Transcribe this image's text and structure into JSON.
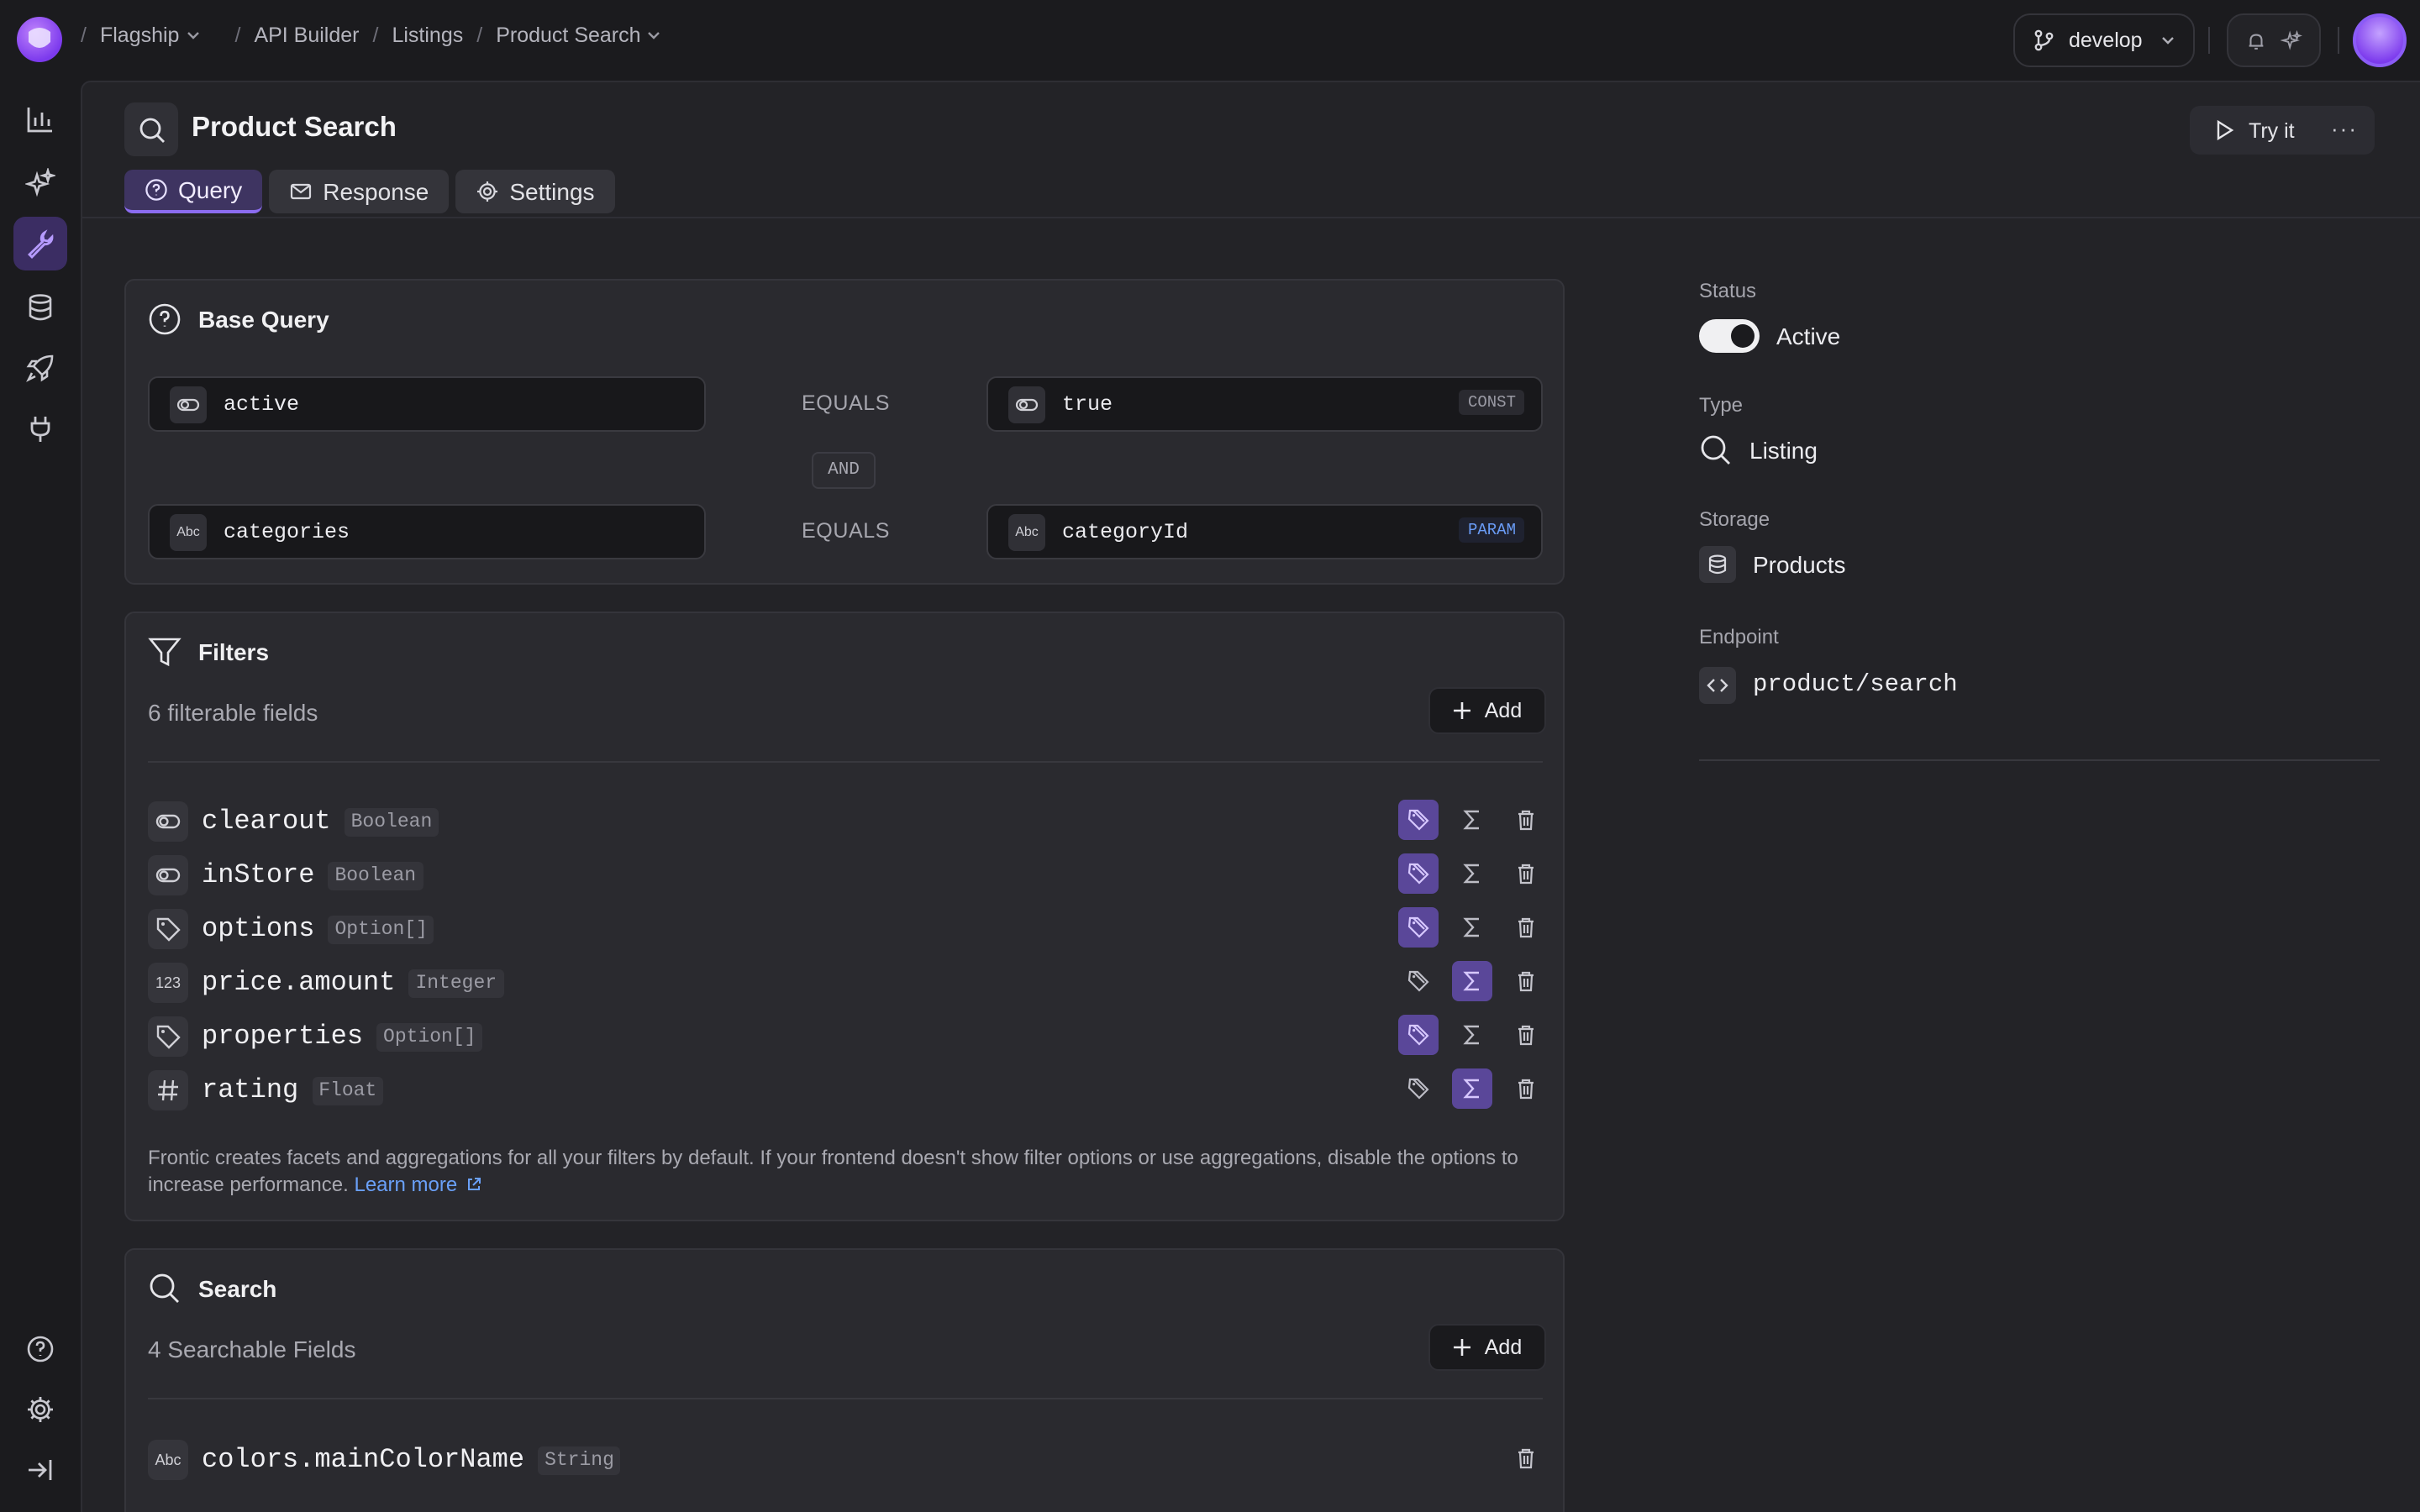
{
  "breadcrumbs": [
    {
      "label": "Flagship",
      "dropdown": true
    },
    {
      "label": "API Builder",
      "dropdown": false
    },
    {
      "label": "Listings",
      "dropdown": false
    },
    {
      "label": "Product Search",
      "dropdown": true
    }
  ],
  "branch": {
    "label": "develop"
  },
  "page": {
    "title": "Product Search",
    "try_label": "Try it",
    "more_label": "···",
    "tabs": [
      {
        "label": "Query",
        "icon": "question-circle-icon",
        "active": true
      },
      {
        "label": "Response",
        "icon": "envelope-icon",
        "active": false
      },
      {
        "label": "Settings",
        "icon": "gear-icon",
        "active": false
      }
    ]
  },
  "base_query": {
    "title": "Base Query",
    "operator_and": "AND",
    "conditions": [
      {
        "field": "active",
        "field_icon": "toggle-icon",
        "op": "EQUALS",
        "value": "true",
        "value_icon": "toggle-icon",
        "tag": "CONST"
      },
      {
        "field": "categories",
        "field_icon": "Abc",
        "op": "EQUALS",
        "value": "categoryId",
        "value_icon": "Abc",
        "tag": "PARAM"
      }
    ]
  },
  "filters": {
    "title": "Filters",
    "count_text": "6 filterable fields",
    "add_label": "Add",
    "rows": [
      {
        "name": "clearout",
        "type": "Boolean",
        "icon": "toggle-icon",
        "facet": true,
        "agg": false
      },
      {
        "name": "inStore",
        "type": "Boolean",
        "icon": "toggle-icon",
        "facet": true,
        "agg": false
      },
      {
        "name": "options",
        "type": "Option[]",
        "icon": "tag-icon",
        "facet": true,
        "agg": false
      },
      {
        "name": "price.amount",
        "type": "Integer",
        "icon": "123",
        "facet": false,
        "agg": true
      },
      {
        "name": "properties",
        "type": "Option[]",
        "icon": "tag-icon",
        "facet": true,
        "agg": false
      },
      {
        "name": "rating",
        "type": "Float",
        "icon": "hash-icon",
        "facet": false,
        "agg": true
      }
    ],
    "note": "Frontic creates facets and aggregations for all your filters by default. If your frontend doesn't show filter options or use aggregations, disable the options to increase performance.",
    "learn_more": "Learn more"
  },
  "search": {
    "title": "Search",
    "count_text": "4 Searchable Fields",
    "add_label": "Add",
    "rows": [
      {
        "name": "colors.mainColorName",
        "type": "String",
        "icon": "Abc"
      }
    ]
  },
  "details": {
    "status_label": "Status",
    "status_value": "Active",
    "type_label": "Type",
    "type_value": "Listing",
    "storage_label": "Storage",
    "storage_value": "Products",
    "endpoint_label": "Endpoint",
    "endpoint_value": "product/search"
  },
  "colors": {
    "accent": "#8b5cf6",
    "link": "#6aa0f8",
    "background": "#1b1b1e",
    "panel": "#232327"
  }
}
